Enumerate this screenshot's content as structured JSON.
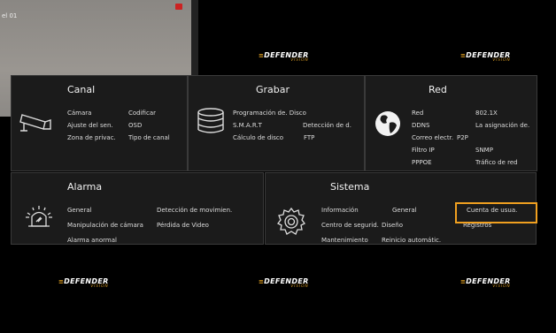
{
  "camera": {
    "label": "el 01"
  },
  "logo": {
    "brand": "DEFENDER",
    "sub": "VISION"
  },
  "canal": {
    "title": "Canal",
    "items": [
      "Cámara",
      "Codificar",
      "Ajuste del sen.",
      "OSD",
      "Zona de privac.",
      "Tipo de canal"
    ]
  },
  "grabar": {
    "title": "Grabar",
    "items": [
      "Programación de. Disco",
      "S.M.A.R.T",
      "Detección de d.",
      "Cálculo de disco",
      "FTP"
    ]
  },
  "red": {
    "title": "Red",
    "items": [
      "Red",
      "802.1X",
      "DDNS",
      "La asignación de.",
      "Correo electr.",
      "P2P",
      "Filtro IP",
      "SNMP",
      "PPPOE",
      "Tráfico de red"
    ]
  },
  "alarma": {
    "title": "Alarma",
    "items": [
      "General",
      "Detección de movimien.",
      "Manipulación de cámara",
      "Pérdida de Video",
      "Alarma anormal"
    ]
  },
  "sistema": {
    "title": "Sistema",
    "items": [
      "Información",
      "General",
      "Cuenta de usua.",
      "Centro de segurid.",
      "Diseño",
      "Registros",
      "Mantenimiento",
      "Reinicio automátic."
    ]
  },
  "colors": {
    "panel": "#1b1b1b",
    "border": "#3a3a3a",
    "highlight": "#f0a020"
  }
}
